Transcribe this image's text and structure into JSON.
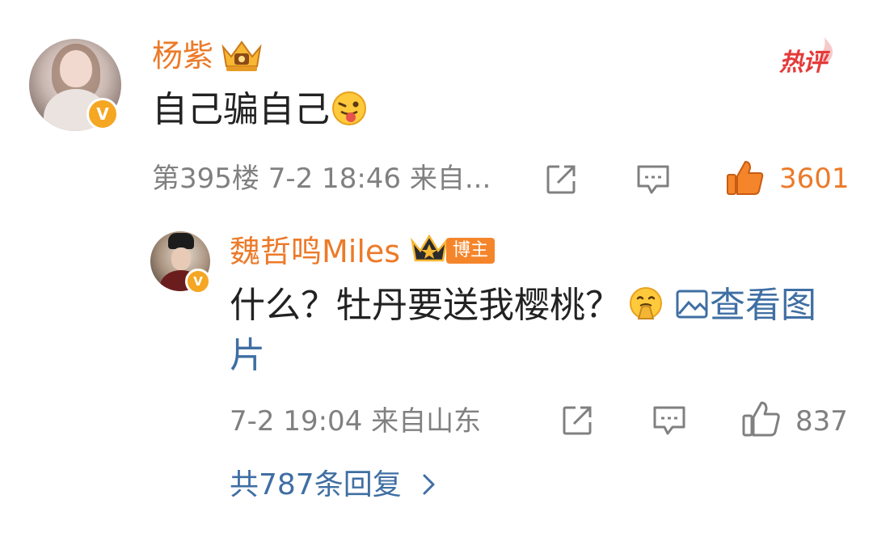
{
  "main_comment": {
    "username": "杨紫",
    "text": "自己骗自己",
    "emoji_icon": "tongue-wink-emoji",
    "hot_label": "热评",
    "floor": "第395楼",
    "time": "7-2 18:46",
    "source": "来自...",
    "likes": "3601",
    "colors": {
      "name": "#ec7a29",
      "like_active": "#ec7a29",
      "hot": "#e53a3a"
    }
  },
  "reply": {
    "username": "魏哲鸣Miles",
    "badge": "博主",
    "text": "什么？牡丹要送我樱桃？",
    "emoji_icon": "shushing-face-emoji",
    "image_link_line1": "查看图",
    "image_link_line2": "片",
    "time": "7-2 19:04",
    "source": "来自山东",
    "likes": "837",
    "colors": {
      "name": "#ec7a29",
      "badge_bg": "#f5852a",
      "link": "#3f6fa3"
    }
  },
  "more_replies": "共787条回复"
}
